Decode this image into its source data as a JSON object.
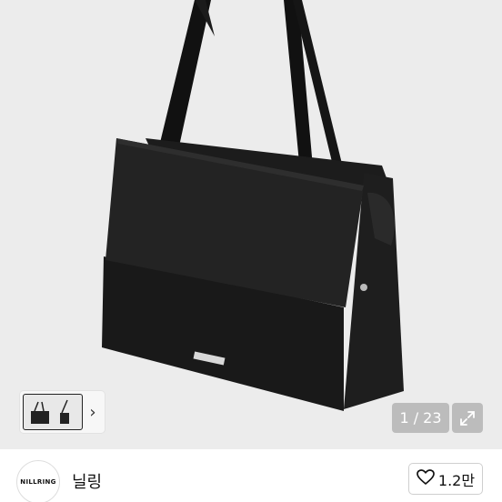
{
  "gallery": {
    "counter": "1 / 23",
    "next_thumb_icon": "chevron-right-icon",
    "expand_icon": "expand-icon"
  },
  "shop": {
    "logo_text": "NILLRING",
    "name": "닐링",
    "like_count": "1.2만",
    "like_icon": "heart-outline-icon"
  },
  "product_brand_plate": "NILLRING"
}
